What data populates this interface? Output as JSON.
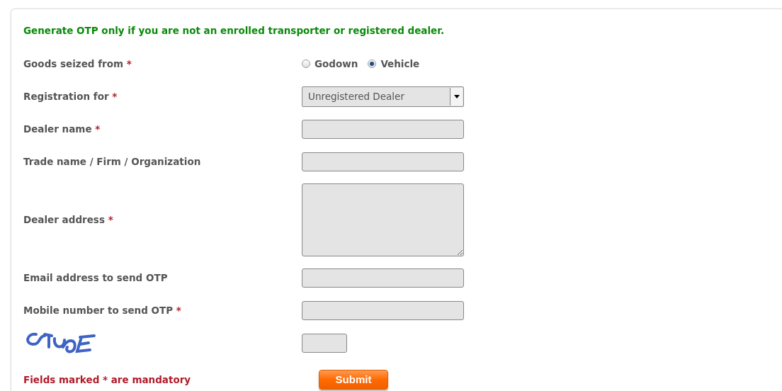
{
  "notice": "Generate OTP only if you are not an enrolled transporter or registered dealer.",
  "fields": [
    {
      "kind": "radio",
      "label": "Goods seized from",
      "required_mark": "*",
      "options": [
        {
          "label": "Godown",
          "selected": false
        },
        {
          "label": "Vehicle",
          "selected": true
        }
      ]
    },
    {
      "kind": "select",
      "label": "Registration for",
      "required_mark": "*",
      "value": "Unregistered Dealer"
    },
    {
      "kind": "text",
      "label": "Dealer name",
      "required_mark": "*"
    },
    {
      "kind": "text",
      "label": "Trade name / Firm / Organization"
    },
    {
      "kind": "textarea",
      "label": "Dealer address",
      "required_mark": "*"
    },
    {
      "kind": "text",
      "label": "Email address to send OTP"
    },
    {
      "kind": "text",
      "label": "Mobile number to send OTP",
      "required_mark": "*"
    },
    {
      "kind": "captcha"
    }
  ],
  "mandatory_note": "Fields marked * are mandatory",
  "submit": "Submit"
}
